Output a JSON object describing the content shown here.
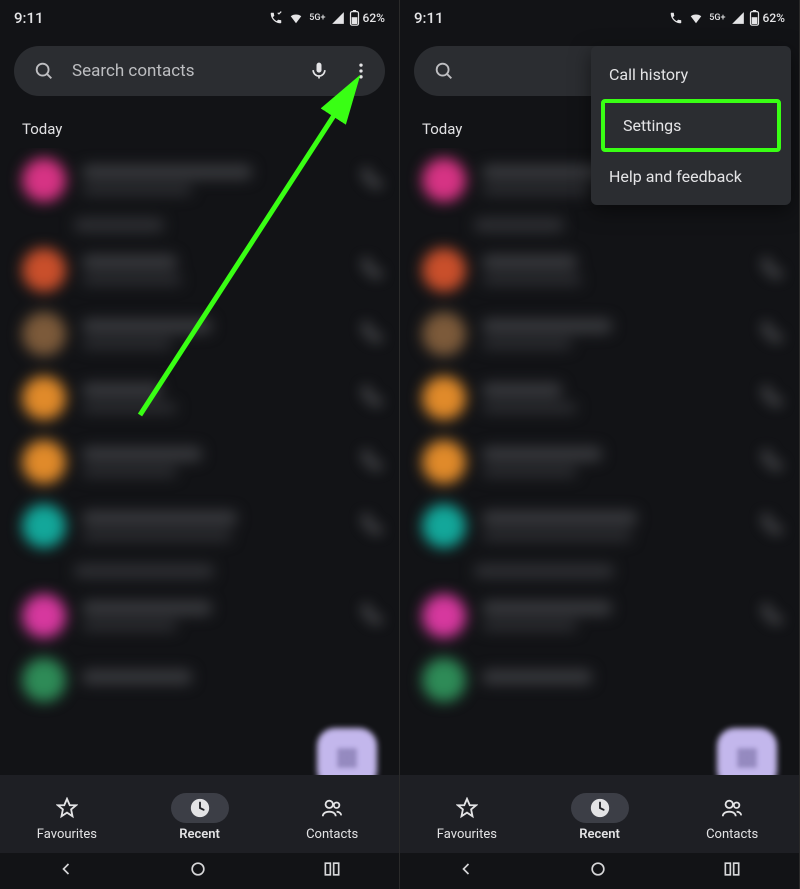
{
  "status": {
    "time": "9:11",
    "net": "5G+",
    "battery": "62%"
  },
  "search": {
    "placeholder": "Search contacts"
  },
  "section_today": "Today",
  "nav": {
    "fav": "Favourites",
    "recent": "Recent",
    "contacts": "Contacts"
  },
  "menu": {
    "history": "Call history",
    "settings": "Settings",
    "help": "Help and feedback"
  },
  "avatars": [
    "#d63384",
    "#c94f2b",
    "#7c5a3a",
    "#e08a2a",
    "#e08a2a",
    "#13a79a",
    "#4a4d55",
    "#d6389e",
    "#2e8b57"
  ]
}
